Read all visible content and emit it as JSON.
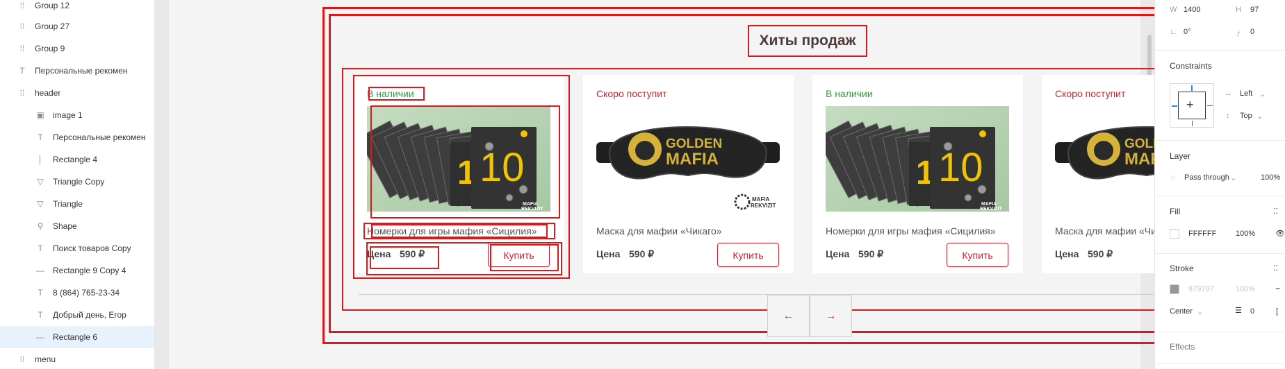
{
  "layers": {
    "items": [
      {
        "label": "Group 12",
        "icon": "frame-icon",
        "indent": 0
      },
      {
        "label": "Group 27",
        "icon": "frame-icon",
        "indent": 0
      },
      {
        "label": "Group 9",
        "icon": "frame-icon",
        "indent": 0
      },
      {
        "label": "Персональные рекомен",
        "icon": "text-icon",
        "indent": 0
      },
      {
        "label": "header",
        "icon": "frame-icon",
        "indent": 0
      },
      {
        "label": "image 1",
        "icon": "image-icon",
        "indent": 1
      },
      {
        "label": "Персональные рекомен",
        "icon": "text-icon",
        "indent": 1
      },
      {
        "label": "Rectangle 4",
        "icon": "vertical-line-icon",
        "indent": 1
      },
      {
        "label": "Triangle Copy",
        "icon": "triangle-icon",
        "indent": 1
      },
      {
        "label": "Triangle",
        "icon": "triangle-icon",
        "indent": 1
      },
      {
        "label": "Shape",
        "icon": "search-icon",
        "indent": 1
      },
      {
        "label": "Поиск товаров Copy",
        "icon": "text-icon",
        "indent": 1
      },
      {
        "label": "Rectangle 9 Copy 4",
        "icon": "line-icon",
        "indent": 1
      },
      {
        "label": "8 (864) 765-23-34",
        "icon": "text-icon",
        "indent": 1
      },
      {
        "label": "Добрый день, Егор",
        "icon": "text-icon",
        "indent": 1
      },
      {
        "label": "Rectangle 6",
        "icon": "line-icon",
        "indent": 1,
        "selected": true
      },
      {
        "label": "menu",
        "icon": "frame-icon",
        "indent": 0
      }
    ]
  },
  "canvas": {
    "section_title": "Хиты продаж",
    "price_label": "Цена",
    "buy_label": "Купить",
    "prev_arrow": "←",
    "next_arrow": "→",
    "products": [
      {
        "availability": "В наличии",
        "status": "in",
        "name": "Номерки для игры мафия «Сицилия»",
        "price": "590 ₽",
        "image": "number-cards"
      },
      {
        "availability": "Скоро поступит",
        "status": "soon",
        "name": "Маска для мафии «Чикаго»",
        "price": "590 ₽",
        "image": "sleep-mask"
      },
      {
        "availability": "В наличии",
        "status": "in",
        "name": "Номерки для игры мафия «Сицилия»",
        "price": "590 ₽",
        "image": "number-cards"
      },
      {
        "availability": "Скоро поступит",
        "status": "soon",
        "name": "Маска для мафии «Чикаго»",
        "price": "590 ₽",
        "image": "sleep-mask"
      }
    ],
    "image_text": {
      "card_number": "10",
      "card_number_partial": "1",
      "mask_line1": "GOLDEN",
      "mask_line2": "MAFIA",
      "brand_line1": "MAFIA",
      "brand_line2": "REKVIZIT"
    },
    "colors": {
      "accent": "#d81d2d",
      "available": "#2d9b3b",
      "highlight": "#e0161b"
    }
  },
  "props": {
    "w_label": "W",
    "w_value": "1400",
    "h_label": "H",
    "h_value": "97",
    "rotation_value": "0°",
    "radius_value": "0",
    "constraints_title": "Constraints",
    "constraint_h": "Left",
    "constraint_v": "Top",
    "layer_title": "Layer",
    "blend_mode": "Pass through",
    "layer_opacity": "100%",
    "fill_title": "Fill",
    "fill_hex": "FFFFFF",
    "fill_opacity": "100%",
    "stroke_title": "Stroke",
    "stroke_hex": "979797",
    "stroke_opacity": "100%",
    "stroke_align": "Center",
    "stroke_width": "0",
    "effects_title": "Effects"
  }
}
